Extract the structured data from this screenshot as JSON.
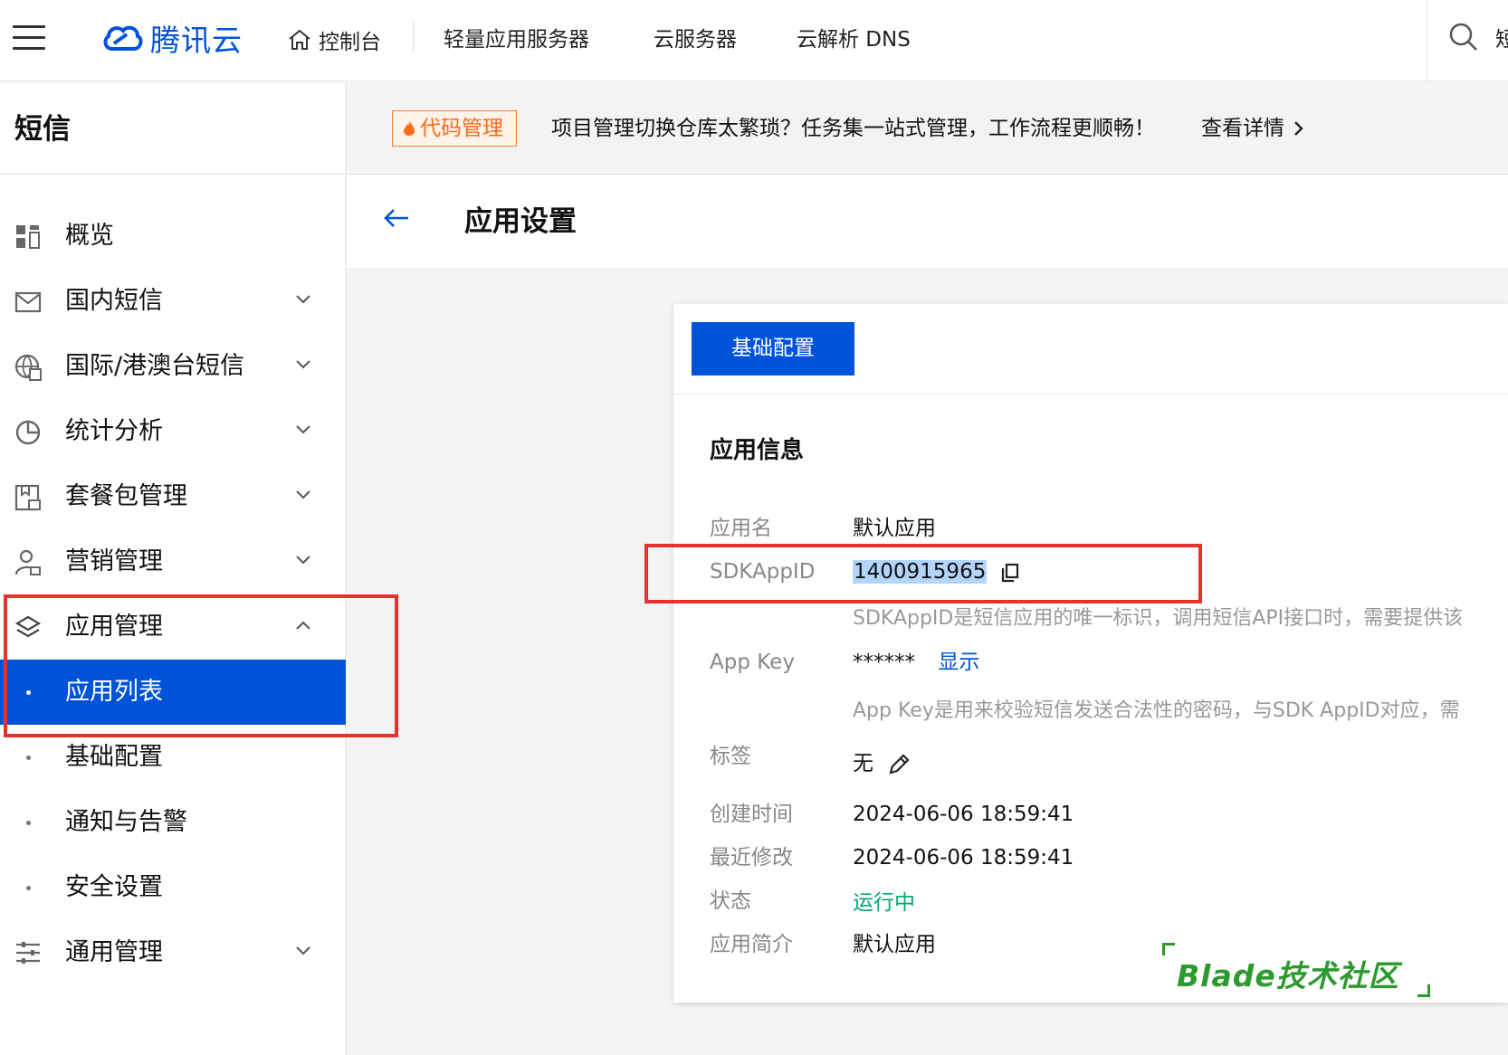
{
  "topnav": {
    "brand": "腾讯云",
    "home_label": "控制台",
    "items": [
      "轻量应用服务器",
      "云服务器",
      "云解析 DNS"
    ],
    "cut_text": "短"
  },
  "sidebar": {
    "title": "短信",
    "items": [
      {
        "label": "概览",
        "icon": "grid-icon",
        "chevron": "none"
      },
      {
        "label": "国内短信",
        "icon": "mail-icon",
        "chevron": "down"
      },
      {
        "label": "国际/港澳台短信",
        "icon": "globe-icon",
        "chevron": "down"
      },
      {
        "label": "统计分析",
        "icon": "pie-chart-icon",
        "chevron": "down"
      },
      {
        "label": "套餐包管理",
        "icon": "package-icon",
        "chevron": "down"
      },
      {
        "label": "营销管理",
        "icon": "user-group-icon",
        "chevron": "down"
      },
      {
        "label": "应用管理",
        "icon": "layers-icon",
        "chevron": "up"
      }
    ],
    "subitems": [
      {
        "label": "应用列表",
        "active": true
      },
      {
        "label": "基础配置",
        "active": false
      },
      {
        "label": "通知与告警",
        "active": false
      },
      {
        "label": "安全设置",
        "active": false
      }
    ],
    "last_item": {
      "label": "通用管理",
      "icon": "sliders-icon",
      "chevron": "down"
    }
  },
  "banner": {
    "tag": "代码管理",
    "text": "项目管理切换仓库太繁琐？任务集一站式管理，工作流程更顺畅！",
    "link": "查看详情"
  },
  "header": {
    "title": "应用设置"
  },
  "card": {
    "tab": "基础配置",
    "section_title": "应用信息",
    "rows": {
      "app_name": {
        "label": "应用名",
        "value": "默认应用"
      },
      "sdk_app_id": {
        "label": "SDKAppID",
        "value": "1400915965",
        "help": "SDKAppID是短信应用的唯一标识，调用短信API接口时，需要提供该"
      },
      "app_key": {
        "label": "App Key",
        "value": "******",
        "action": "显示",
        "help": "App Key是用来校验短信发送合法性的密码，与SDK AppID对应，需"
      },
      "tags": {
        "label": "标签",
        "value": "无"
      },
      "created": {
        "label": "创建时间",
        "value": "2024-06-06 18:59:41"
      },
      "modified": {
        "label": "最近修改",
        "value": "2024-06-06 18:59:41"
      },
      "status": {
        "label": "状态",
        "value": "运行中"
      },
      "intro": {
        "label": "应用简介",
        "value": "默认应用"
      }
    }
  },
  "watermark": "Blade技术社区",
  "colors": {
    "primary": "#0052d9",
    "highlight_red": "#e5322d",
    "status_green": "#00a870",
    "banner_orange": "#ff6b1a"
  }
}
